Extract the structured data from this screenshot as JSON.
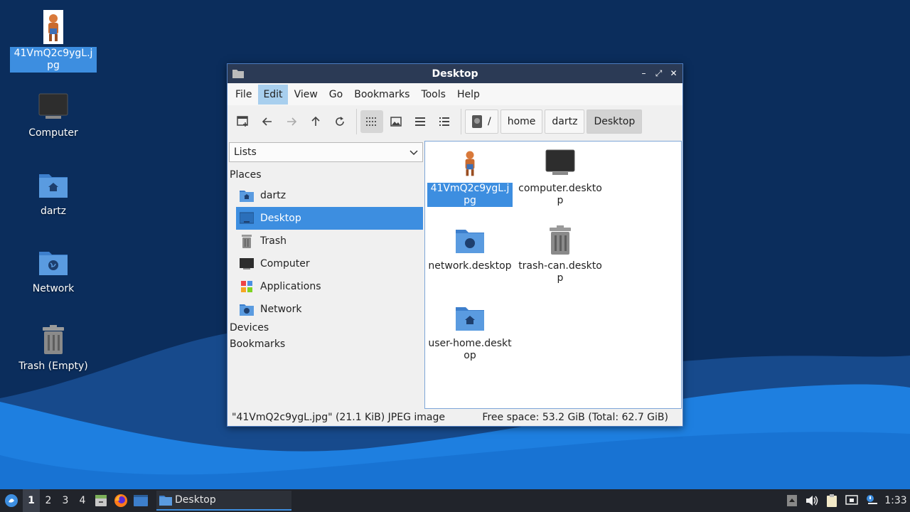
{
  "desktop": {
    "icons": [
      {
        "label": "41VmQ2c9ygL.jpg",
        "icon": "image-thumbnail-icon"
      },
      {
        "label": "Computer",
        "icon": "computer-icon"
      },
      {
        "label": "dartz",
        "icon": "home-folder-icon"
      },
      {
        "label": "Network",
        "icon": "network-folder-icon"
      },
      {
        "label": "Trash (Empty)",
        "icon": "trash-icon"
      }
    ]
  },
  "window": {
    "title": "Desktop",
    "controls": {
      "minimize": "–",
      "maximize": "⤢",
      "close": "✕"
    },
    "menu": [
      "File",
      "Edit",
      "View",
      "Go",
      "Bookmarks",
      "Tools",
      "Help"
    ],
    "active_menu": "Edit",
    "path": {
      "root": "/",
      "crumbs": [
        "home",
        "dartz",
        "Desktop"
      ]
    },
    "side": {
      "selector": "Lists",
      "places_header": "Places",
      "places": [
        {
          "label": "dartz",
          "icon": "home-folder-icon"
        },
        {
          "label": "Desktop",
          "icon": "desktop-icon"
        },
        {
          "label": "Trash",
          "icon": "trash-icon"
        },
        {
          "label": "Computer",
          "icon": "computer-icon"
        },
        {
          "label": "Applications",
          "icon": "applications-icon"
        },
        {
          "label": "Network",
          "icon": "network-folder-icon"
        }
      ],
      "devices_header": "Devices",
      "bookmarks_header": "Bookmarks"
    },
    "files": [
      {
        "label": "41VmQ2c9ygL.jpg",
        "icon": "image-thumbnail-icon",
        "selected": true
      },
      {
        "label": "computer.desktop",
        "icon": "computer-icon"
      },
      {
        "label": "network.desktop",
        "icon": "network-folder-icon"
      },
      {
        "label": "trash-can.desktop",
        "icon": "trash-icon"
      },
      {
        "label": "user-home.desktop",
        "icon": "home-folder-icon"
      }
    ],
    "status": {
      "left": "\"41VmQ2c9ygL.jpg\" (21.1 KiB) JPEG image",
      "right": "Free space: 53.2 GiB (Total: 62.7 GiB)"
    }
  },
  "taskbar": {
    "workspaces": [
      "1",
      "2",
      "3",
      "4"
    ],
    "active_workspace": "1",
    "task_label": "Desktop",
    "clock": "1:33"
  },
  "colors": {
    "accent": "#3d8ee0",
    "titlebar": "#2b3a55",
    "taskbar": "#21242b",
    "wallpaper_dark": "#0b2d5c",
    "wallpaper_wave": "#1e7fe0"
  }
}
